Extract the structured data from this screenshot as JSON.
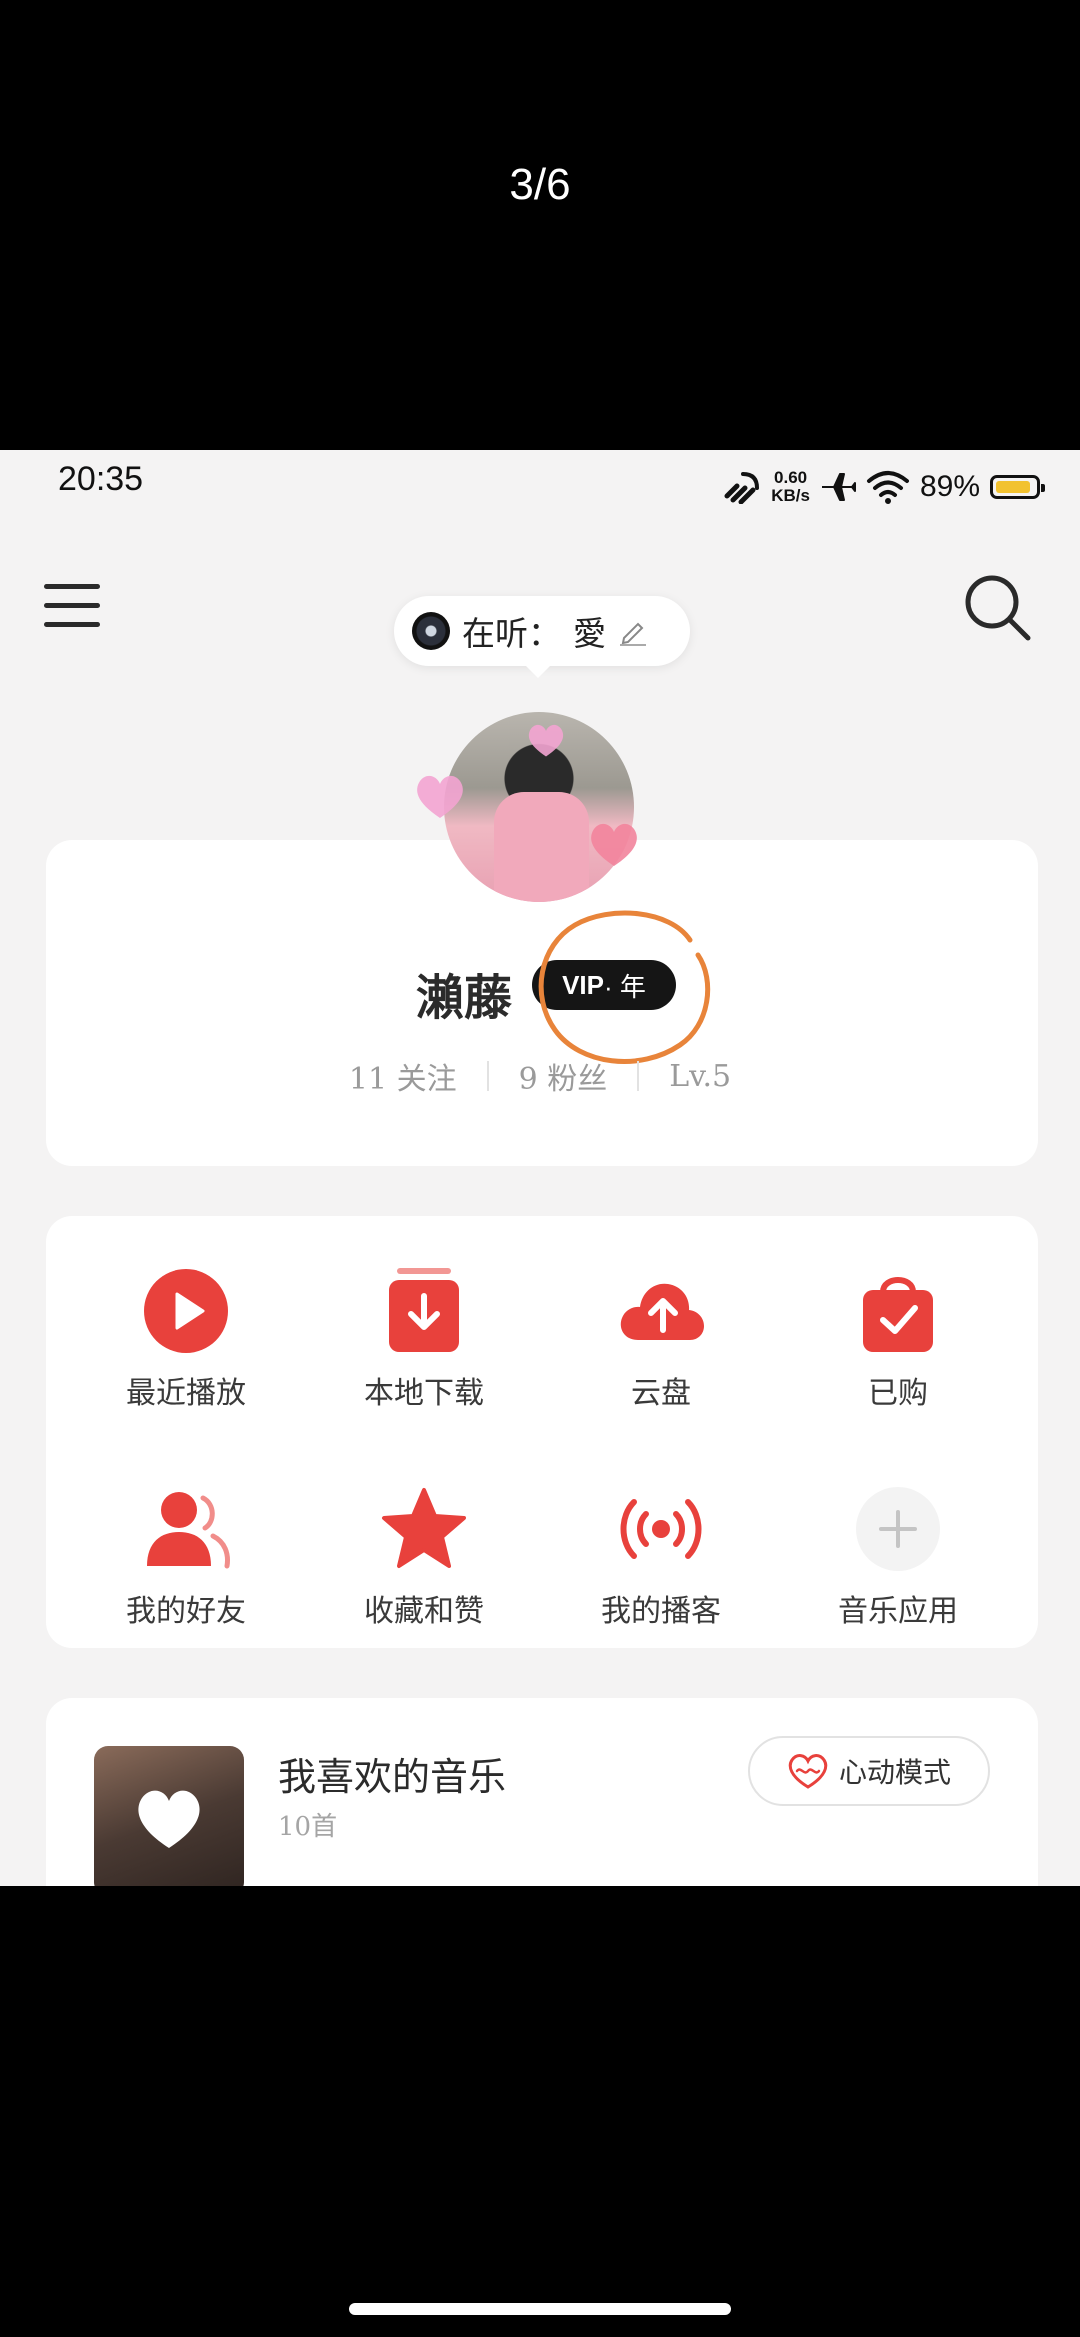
{
  "page_counter": "3/6",
  "status_bar": {
    "time": "20:35",
    "net_speed_value": "0.60",
    "net_speed_unit": "KB/s",
    "battery_percent": "89%",
    "battery_level": 0.89,
    "battery_color": "#f2c230"
  },
  "header": {
    "menu_icon": "menu-icon",
    "search_icon": "search-icon",
    "now_playing_label": "在听：",
    "now_playing_value": "愛"
  },
  "profile": {
    "name": "瀨藤",
    "vip_badge": "VIP",
    "vip_suffix": "· 年",
    "following": "11 关注",
    "followers": "9 粉丝",
    "level": "Lv.5"
  },
  "shortcuts": [
    {
      "label": "最近播放",
      "icon": "play-icon"
    },
    {
      "label": "本地下载",
      "icon": "download-icon"
    },
    {
      "label": "云盘",
      "icon": "cloud-upload-icon"
    },
    {
      "label": "已购",
      "icon": "shopping-bag-icon"
    },
    {
      "label": "我的好友",
      "icon": "friends-icon"
    },
    {
      "label": "收藏和赞",
      "icon": "star-icon"
    },
    {
      "label": "我的播客",
      "icon": "broadcast-icon"
    },
    {
      "label": "音乐应用",
      "icon": "plus-icon"
    }
  ],
  "liked_playlist": {
    "title": "我喜欢的音乐",
    "count": "10首",
    "heartbeat_mode": "心动模式"
  },
  "colors": {
    "accent": "#e8413c",
    "annotation": "#e8843a"
  }
}
